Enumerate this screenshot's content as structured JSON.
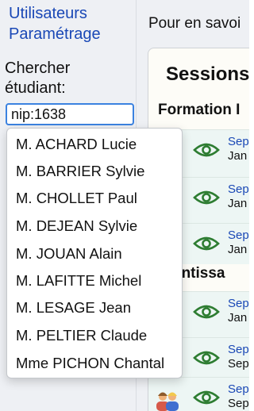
{
  "sidebar": {
    "nav": {
      "users": "Utilisateurs",
      "settings": "Paramétrage"
    },
    "search": {
      "label_line1": "Chercher",
      "label_line2": "étudiant:",
      "value": "nip:1638"
    }
  },
  "autocomplete": {
    "items": [
      "M. ACHARD Lucie",
      "M. BARRIER Sylvie",
      "M. CHOLLET Paul",
      "M. DEJEAN Sylvie",
      "M. JOUAN Alain",
      "M. LAFITTE Michel",
      "M. LESAGE Jean",
      "M. PELTIER Claude",
      "Mme PICHON Chantal"
    ]
  },
  "main": {
    "info_text": "Pour en savoi",
    "sessions_title": "Sessions",
    "sections": {
      "formation": "Formation I",
      "apprentissage": "prentissa"
    },
    "rows": [
      {
        "line1": "Sep",
        "line2": "Jan"
      },
      {
        "line1": "Sep",
        "line2": "Jan"
      },
      {
        "line1": "Sep",
        "line2": "Jan"
      },
      {
        "line1": "Sep",
        "line2": "Jan"
      },
      {
        "line1": "Sep",
        "line2": "Sep"
      },
      {
        "line1": "Sep",
        "line2": "Sep"
      }
    ]
  },
  "colors": {
    "link": "#1a48b6",
    "eye": "#2e7d32",
    "row_bg": "#edf6f4",
    "panel_bg": "#fdfcf7",
    "input_focus": "#3b82e0"
  }
}
